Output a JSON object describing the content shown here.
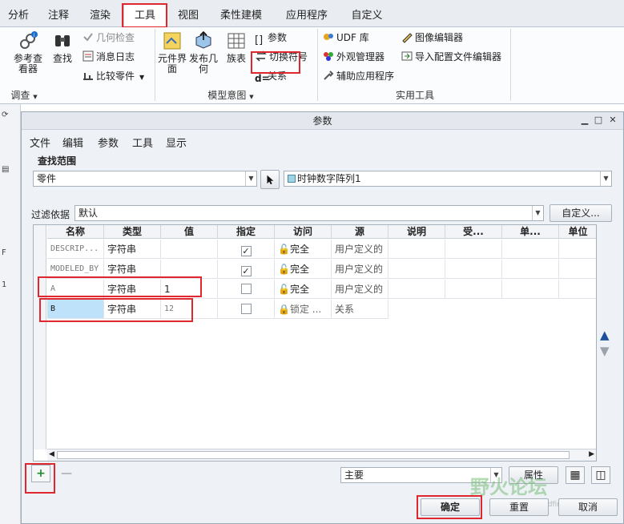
{
  "ribbon": {
    "tabs": [
      {
        "label": "分析"
      },
      {
        "label": "注释"
      },
      {
        "label": "渲染"
      },
      {
        "label": "工具"
      },
      {
        "label": "视图"
      },
      {
        "label": "柔性建模"
      },
      {
        "label": "应用程序"
      },
      {
        "label": "自定义"
      }
    ],
    "active_tab": "工具",
    "groups": {
      "investigate": {
        "label": "调查",
        "model_viewer": "参考查看器",
        "find": "查找",
        "geometry_check": "几何检查",
        "message_log": "消息日志",
        "compare_parts": "比较零件"
      },
      "model_intent": {
        "label": "模型意图",
        "component_interface": "元件界面",
        "publish_geometry": "发布几何",
        "family_table": "族表",
        "parameters": "参数",
        "switch_symbols": "切换符号",
        "relations": "关系"
      },
      "utilities": {
        "label": "实用工具",
        "udf_library": "UDF 库",
        "appearance_manager": "外观管理器",
        "auxiliary_apps": "辅助应用程序",
        "image_editor": "图像编辑器",
        "import_config_editor": "导入配置文件编辑器"
      }
    }
  },
  "dialog": {
    "title": "参数",
    "menus": [
      "文件",
      "编辑",
      "参数",
      "工具",
      "显示"
    ],
    "look_in_label": "查找范围",
    "look_in_type": "零件",
    "look_in_item": "时钟数字阵列1",
    "filter_label": "过滤依据",
    "filter_value": "默认",
    "customize_label": "自定义...",
    "columns": [
      "名称",
      "类型",
      "值",
      "指定",
      "访问",
      "源",
      "说明",
      "受...",
      "单...",
      "单位"
    ],
    "rows": [
      {
        "name": "DESCRIP...",
        "type": "字符串",
        "value": "",
        "designated": true,
        "access": "完全",
        "source": "用户定义的"
      },
      {
        "name": "MODELED_BY",
        "type": "字符串",
        "value": "",
        "designated": true,
        "access": "完全",
        "source": "用户定义的"
      },
      {
        "name": "A",
        "type": "字符串",
        "value": "1",
        "designated": false,
        "access": "完全",
        "source": "用户定义的"
      },
      {
        "name": "B",
        "type": "字符串",
        "value": "12",
        "designated": false,
        "access": "锁定 ...",
        "source": "关系"
      }
    ],
    "main_select": "主要",
    "properties_label": "属性",
    "ok_label": "确定",
    "reset_label": "重置",
    "cancel_label": "取消",
    "add_glyph": "+",
    "remove_glyph": "—"
  },
  "watermark": {
    "text": "野火论坛",
    "url": "www.proewildfire.cn"
  },
  "icons": {
    "minimize": "minimize-icon",
    "maximize": "maximize-icon",
    "close": "close-icon"
  },
  "colors": {
    "highlight_box": "#e0262e",
    "selected_cell": "#bfe2fb",
    "add_button": "#1e8c2a"
  }
}
